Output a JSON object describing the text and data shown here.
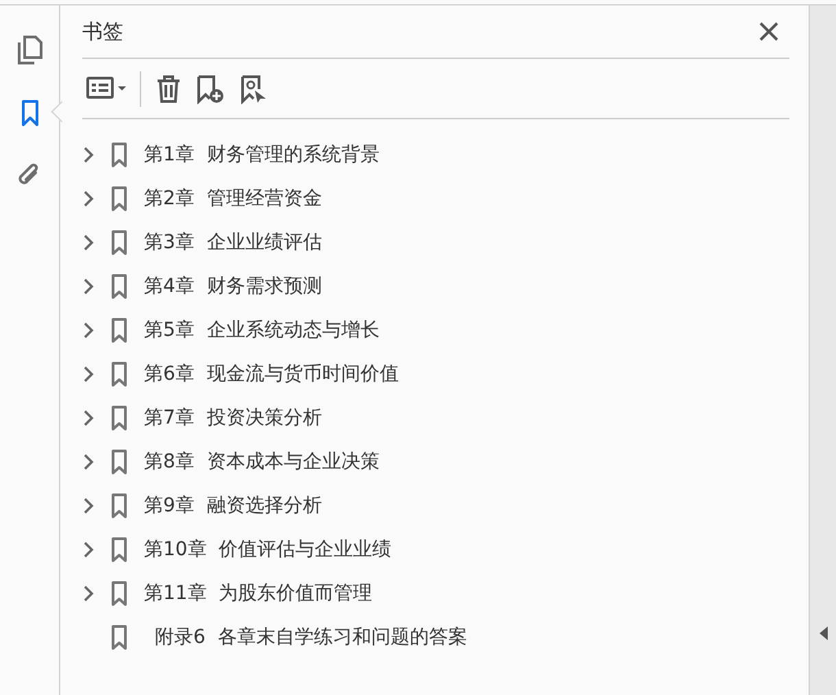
{
  "rail": [
    {
      "kind": "pages",
      "selected": false
    },
    {
      "kind": "bookmarks",
      "selected": true
    },
    {
      "kind": "attachments",
      "selected": false
    }
  ],
  "panel": {
    "title": "书签",
    "toolbar": [
      {
        "kind": "options"
      },
      {
        "kind": "delete"
      },
      {
        "kind": "new"
      },
      {
        "kind": "find"
      }
    ]
  },
  "bookmarks": [
    {
      "label": "第1章  财务管理的系统背景",
      "expandable": true
    },
    {
      "label": "第2章  管理经营资金",
      "expandable": true
    },
    {
      "label": "第3章  企业业绩评估",
      "expandable": true
    },
    {
      "label": "第4章  财务需求预测",
      "expandable": true
    },
    {
      "label": "第5章  企业系统动态与增长",
      "expandable": true
    },
    {
      "label": "第6章  现金流与货币时间价值",
      "expandable": true
    },
    {
      "label": "第7章  投资决策分析",
      "expandable": true
    },
    {
      "label": "第8章  资本成本与企业决策",
      "expandable": true
    },
    {
      "label": "第9章  融资选择分析",
      "expandable": true
    },
    {
      "label": "第10章  价值评估与企业业绩",
      "expandable": true
    },
    {
      "label": "第11章  为股东价值而管理",
      "expandable": true
    },
    {
      "label": "附录6  各章末自学练习和问题的答案",
      "expandable": false
    }
  ]
}
